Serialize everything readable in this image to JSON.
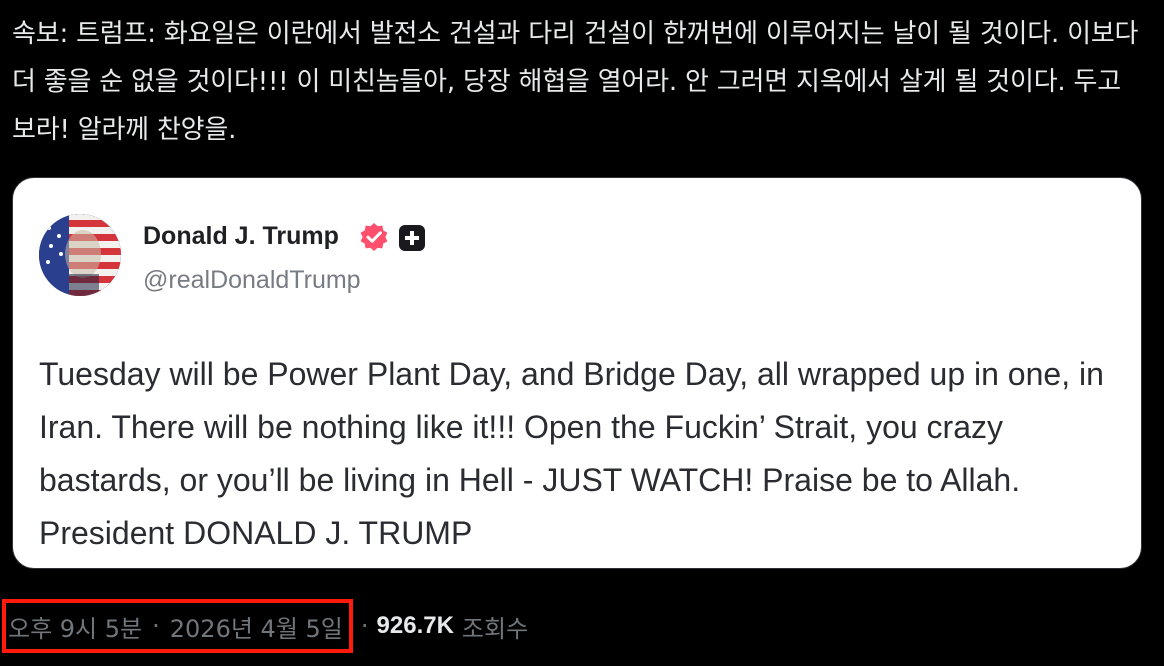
{
  "post": {
    "text": "속보: 트럼프: 화요일은 이란에서 발전소 건설과 다리 건설이 한꺼번에 이루어지는 날이 될 것이다. 이보다 더 좋을 순 없을 것이다!!! 이 미친놈들아, 당장 해협을 열어라. 안 그러면 지옥에서 살게 될 것이다. 두고 보라! 알라께 찬양을."
  },
  "quote": {
    "author_name": "Donald J. Trump",
    "author_handle": "@realDonaldTrump",
    "avatar_icon": "avatar-flag-portrait",
    "verified_icon": "verified-badge-icon",
    "verified_color": "#ff4f6d",
    "plus_icon": "plus-badge-icon",
    "body": "Tuesday will be Power Plant Day, and Bridge Day, all wrapped up in one, in Iran. There will be nothing like it!!! Open the Fuckin’ Strait, you crazy bastards, or you’ll be living in Hell - JUST WATCH! Praise be to Allah. President DONALD J. TRUMP"
  },
  "meta": {
    "time": "오후 9시 5분",
    "separator": "·",
    "date": "2026년 4월 5일",
    "views_count": "926.7K",
    "views_label": "조회수",
    "highlight_color": "#ff1a0a"
  }
}
